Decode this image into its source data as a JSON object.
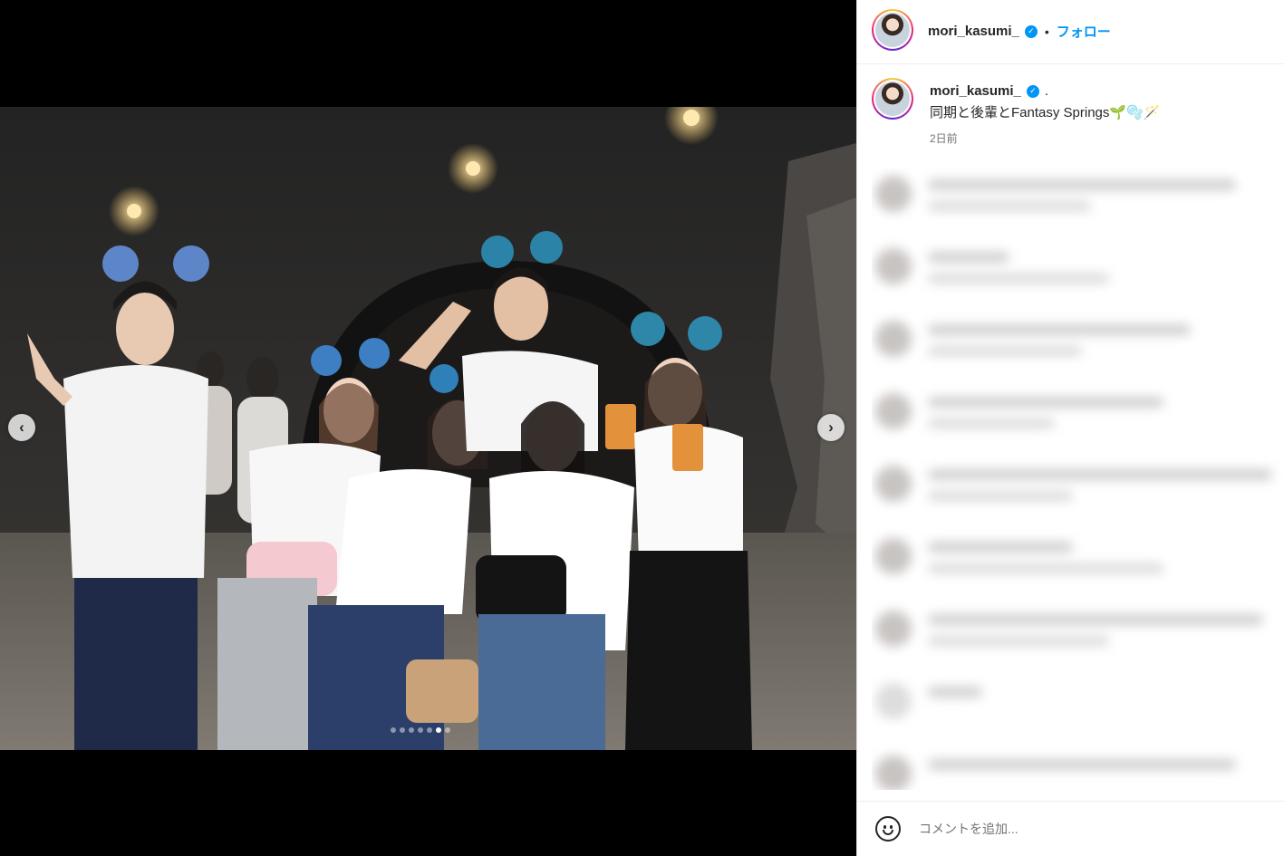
{
  "media": {
    "slide_count": 7,
    "active_slide_index": 5,
    "prev_glyph": "‹",
    "next_glyph": "›"
  },
  "header": {
    "username": "mori_kasumi_",
    "separator": "•",
    "follow_label": "フォロー",
    "verified_glyph": "✓"
  },
  "caption": {
    "username": "mori_kasumi_",
    "trailing": ".",
    "text": "同期と後輩とFantasy Springs🌱🫧🪄",
    "time": "2日前"
  },
  "comment_box": {
    "placeholder": "コメントを追加..."
  },
  "colors": {
    "accent": "#0095f6",
    "text": "#262626",
    "secondary_text": "#737373"
  },
  "icons": [
    "chevron-left-icon",
    "chevron-right-icon",
    "verified-badge-icon",
    "emoji-icon"
  ]
}
